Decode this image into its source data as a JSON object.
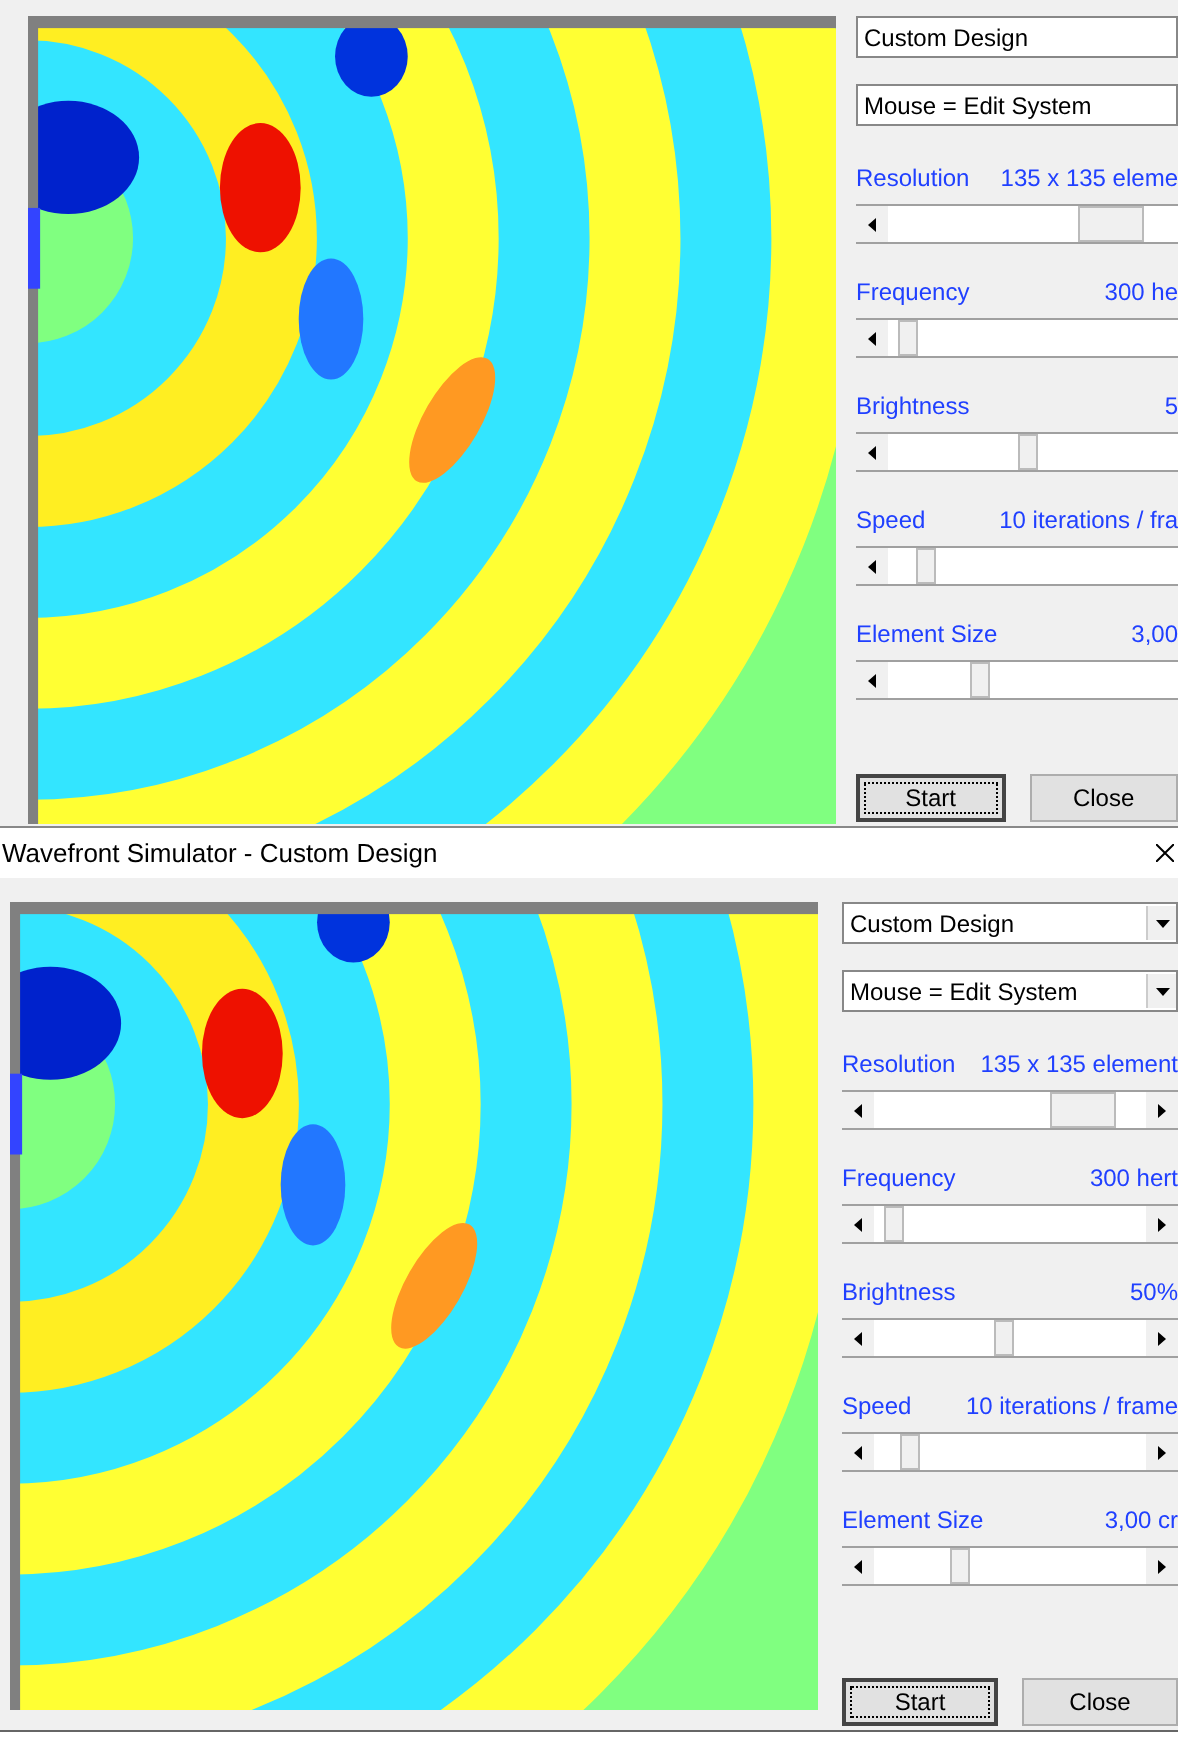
{
  "windows": [
    {
      "kind": "clipped",
      "dropdowns": [
        {
          "value": "Custom Design"
        },
        {
          "value": "Mouse = Edit System"
        }
      ],
      "sliders": [
        {
          "label": "Resolution",
          "reading": "135 x 135 eleme",
          "level": 0.85
        },
        {
          "label": "Frequency",
          "reading": "300 he",
          "level": 0.04
        },
        {
          "label": "Brightness",
          "reading": "5",
          "level": 0.48
        },
        {
          "label": "Speed",
          "reading": "10 iterations / fra",
          "level": 0.1
        },
        {
          "label": "Element Size",
          "reading": "3,00",
          "level": 0.3
        }
      ],
      "buttons": [
        {
          "label": "Start",
          "selected": true
        },
        {
          "label": "Close",
          "selected": false
        }
      ]
    },
    {
      "kind": "full",
      "title": "Wavefront Simulator - Custom Design",
      "dropdowns": [
        {
          "value": "Custom Design"
        },
        {
          "value": "Mouse = Edit System"
        }
      ],
      "sliders": [
        {
          "label": "Resolution",
          "reading": "135 x 135 element",
          "level": 0.85
        },
        {
          "label": "Frequency",
          "reading": "300 hert",
          "level": 0.04
        },
        {
          "label": "Brightness",
          "reading": "50%",
          "level": 0.48
        },
        {
          "label": "Speed",
          "reading": "10 iterations / frame",
          "level": 0.1
        },
        {
          "label": "Element Size",
          "reading": "3,00 cr",
          "level": 0.3
        }
      ],
      "buttons": [
        {
          "label": "Start",
          "selected": true
        },
        {
          "label": "Close",
          "selected": false
        }
      ]
    }
  ]
}
